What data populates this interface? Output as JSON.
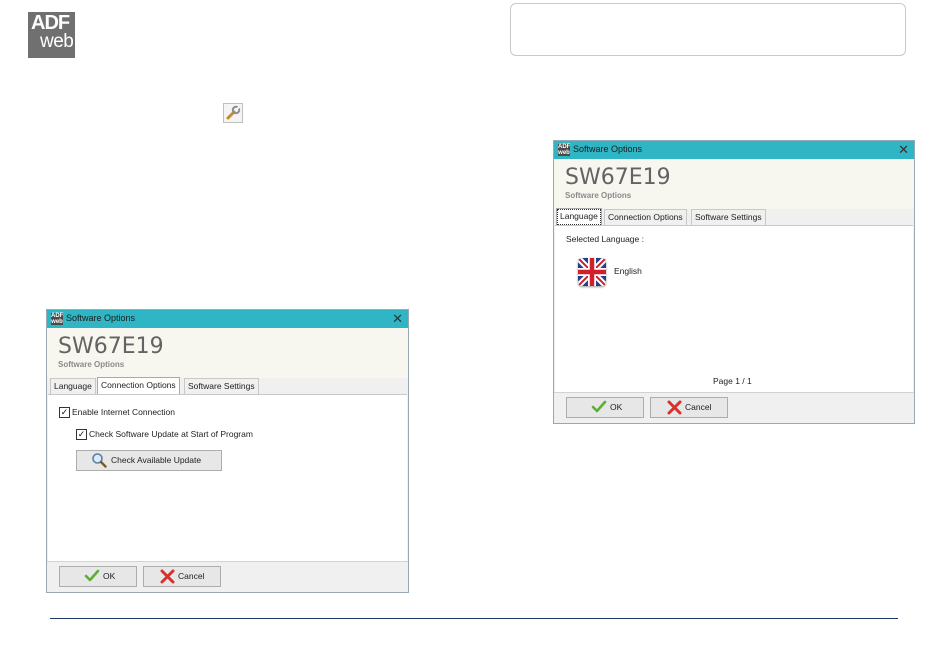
{
  "logo": {
    "top_text": "ADF",
    "bottom_text": "web"
  },
  "icons": {
    "wrench": "wrench-icon",
    "check": "green-check-icon",
    "cross": "red-cross-icon",
    "magnifier": "magnifier-icon",
    "flag": "uk-flag-icon"
  },
  "colors": {
    "titlebar": "#2fb5c3",
    "rule": "#1f3d6b"
  },
  "dialog_left": {
    "title": "Software Options",
    "close": "✕",
    "code": "SW67E19",
    "subtitle": "Software Options",
    "tabs": [
      "Language",
      "Connection Options",
      "Software Settings"
    ],
    "active_tab": "Connection Options",
    "enable_internet": {
      "label": "Enable Internet Connection",
      "checked": true
    },
    "check_update": {
      "label": "Check Software Update at Start of Program",
      "checked": true
    },
    "check_button": "Check Available Update",
    "ok": "OK",
    "cancel": "Cancel"
  },
  "dialog_right": {
    "title": "Software Options",
    "close": "✕",
    "code": "SW67E19",
    "subtitle": "Software Options",
    "tabs": [
      "Language",
      "Connection Options",
      "Software Settings"
    ],
    "active_tab": "Language",
    "selected_language_label": "Selected Language :",
    "language": "English",
    "page": "Page 1 / 1",
    "ok": "OK",
    "cancel": "Cancel"
  }
}
